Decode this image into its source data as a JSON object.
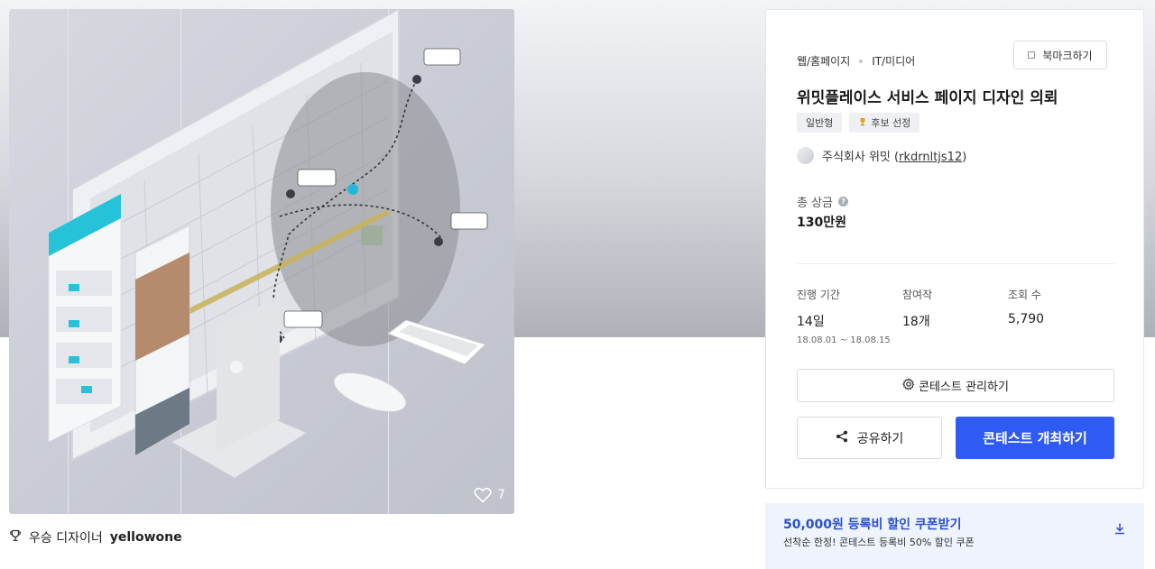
{
  "hero": {
    "likes_count": "7"
  },
  "winner": {
    "label": "우승 디자이너",
    "name": "yellowone"
  },
  "contest": {
    "category_primary": "웹/홈페이지",
    "category_secondary": "IT/미디어",
    "bookmark_label": "북마크하기",
    "title": "위밋플레이스 서비스 페이지 디자인 의뢰",
    "tags": [
      "일반형",
      "후보 선정"
    ],
    "host_name": "주식회사 위밋 (",
    "host_id": "rkdrnltjs12",
    "host_close": ")",
    "prize_label": "총 상금",
    "prize_value": "130만원",
    "period_label": "진행 기간",
    "period_value": "14일",
    "period_dates": "18.08.01 ~ 18.08.15",
    "entries_label": "참여작",
    "entries_value": "18개",
    "views_label": "조회 수",
    "views_value": "5,790",
    "manage_label": "콘테스트 관리하기",
    "share_label": "공유하기",
    "host_contest_label": "콘테스트 개최하기"
  },
  "coupon": {
    "title": "50,000원 등록비 할인 쿠폰받기",
    "subtitle": "선착순 한정! 콘테스트 등록비 50% 할인 쿠폰"
  },
  "colors": {
    "primary": "#2f5bf5",
    "coupon_bg": "#eef3fd",
    "coupon_text": "#2a4fd0"
  }
}
